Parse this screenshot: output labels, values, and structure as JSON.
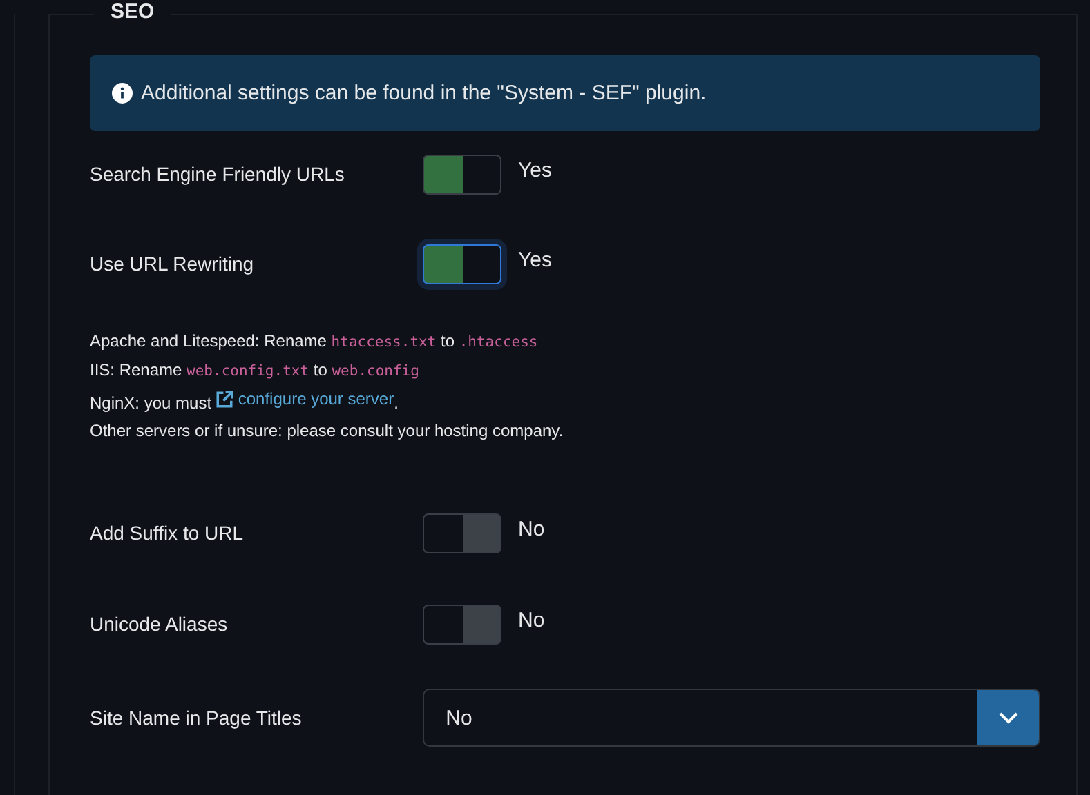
{
  "section": {
    "legend": "SEO"
  },
  "alert": {
    "text": "Additional settings can be found in the \"System - SEF\" plugin."
  },
  "settings_top": [
    {
      "label": "Search Engine Friendly URLs",
      "on": true,
      "focused": false,
      "value": "Yes"
    },
    {
      "label": "Use URL Rewriting",
      "on": true,
      "focused": true,
      "value": "Yes"
    }
  ],
  "notes": [
    [
      {
        "kind": "text",
        "text": "Apache and Litespeed: Rename "
      },
      {
        "kind": "code",
        "text": "htaccess.txt"
      },
      {
        "kind": "text",
        "text": " to "
      },
      {
        "kind": "code",
        "text": ".htaccess"
      }
    ],
    [
      {
        "kind": "text",
        "text": "IIS: Rename "
      },
      {
        "kind": "code",
        "text": "web.config.txt"
      },
      {
        "kind": "text",
        "text": " to "
      },
      {
        "kind": "code",
        "text": "web.config"
      }
    ],
    [
      {
        "kind": "text",
        "text": "NginX: you must "
      },
      {
        "kind": "link",
        "text": "configure your server"
      },
      {
        "kind": "text",
        "text": "."
      }
    ],
    [
      {
        "kind": "text",
        "text": "Other servers or if unsure: please consult your hosting company."
      }
    ]
  ],
  "settings_bottom": [
    {
      "label": "Add Suffix to URL",
      "on": false,
      "focused": false,
      "value": "No"
    },
    {
      "label": "Unicode Aliases",
      "on": false,
      "focused": false,
      "value": "No"
    }
  ],
  "select": {
    "label": "Site Name in Page Titles",
    "value": "No"
  }
}
